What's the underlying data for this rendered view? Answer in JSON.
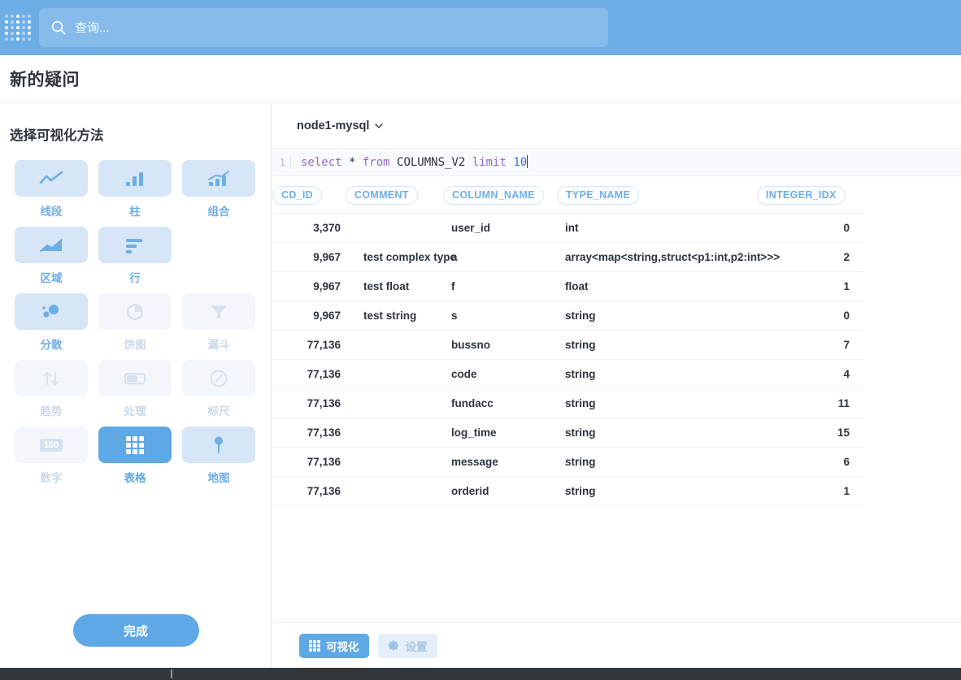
{
  "topbar": {
    "logo_name": "app-logo",
    "search": {
      "placeholder": "查询...",
      "value": "",
      "icon": "search-icon"
    },
    "bg_color": "#6EAEE7"
  },
  "header": {
    "title": "新的疑问"
  },
  "sidebar": {
    "title": "选择可视化方法",
    "done_label": "完成",
    "items": [
      {
        "label": "线段",
        "icon": "line-chart-icon",
        "state": "enabled"
      },
      {
        "label": "柱",
        "icon": "bar-chart-icon",
        "state": "enabled"
      },
      {
        "label": "组合",
        "icon": "combo-chart-icon",
        "state": "enabled"
      },
      {
        "label": "区域",
        "icon": "area-chart-icon",
        "state": "enabled"
      },
      {
        "label": "行",
        "icon": "row-chart-icon",
        "state": "enabled"
      },
      {
        "label": "",
        "icon": "",
        "state": "empty"
      },
      {
        "label": "分散",
        "icon": "scatter-chart-icon",
        "state": "enabled"
      },
      {
        "label": "饼图",
        "icon": "pie-chart-icon",
        "state": "disabled"
      },
      {
        "label": "漏斗",
        "icon": "funnel-icon",
        "state": "disabled"
      },
      {
        "label": "趋势",
        "icon": "trend-arrows-icon",
        "state": "disabled"
      },
      {
        "label": "处理",
        "icon": "progress-icon",
        "state": "disabled"
      },
      {
        "label": "标尺",
        "icon": "gauge-icon",
        "state": "disabled"
      },
      {
        "label": "数字",
        "icon": "number-100-icon",
        "state": "disabled"
      },
      {
        "label": "表格",
        "icon": "table-grid-icon",
        "state": "selected"
      },
      {
        "label": "地图",
        "icon": "map-pin-icon",
        "state": "enabled"
      }
    ],
    "badge_text": "100"
  },
  "main": {
    "database": {
      "name": "node1-mysql",
      "chevron": "chevron-down-icon"
    },
    "editor": {
      "line_number": "1",
      "tokens": [
        {
          "text": "select",
          "type": "keyword"
        },
        {
          "text": " * ",
          "type": "plain"
        },
        {
          "text": "from",
          "type": "keyword"
        },
        {
          "text": " COLUMNS_V2 ",
          "type": "plain"
        },
        {
          "text": "limit",
          "type": "keyword"
        },
        {
          "text": " ",
          "type": "plain"
        },
        {
          "text": "10",
          "type": "number"
        }
      ],
      "full_text": "select * from COLUMNS_V2 limit 10"
    },
    "table": {
      "columns": [
        "CD_ID",
        "COMMENT",
        "COLUMN_NAME",
        "TYPE_NAME",
        "INTEGER_IDX"
      ],
      "rows": [
        [
          "3,370",
          "",
          "user_id",
          "int",
          "0"
        ],
        [
          "9,967",
          "test complex type",
          "a",
          "array<map<string,struct<p1:int,p2:int>>>",
          "2"
        ],
        [
          "9,967",
          "test float",
          "f",
          "float",
          "1"
        ],
        [
          "9,967",
          "test string",
          "s",
          "string",
          "0"
        ],
        [
          "77,136",
          "",
          "bussno",
          "string",
          "7"
        ],
        [
          "77,136",
          "",
          "code",
          "string",
          "4"
        ],
        [
          "77,136",
          "",
          "fundacc",
          "string",
          "11"
        ],
        [
          "77,136",
          "",
          "log_time",
          "string",
          "15"
        ],
        [
          "77,136",
          "",
          "message",
          "string",
          "6"
        ],
        [
          "77,136",
          "",
          "orderid",
          "string",
          "1"
        ]
      ]
    },
    "toolbar": {
      "visualize_label": "可视化",
      "visualize_icon": "table-grid-icon",
      "settings_label": "设置",
      "settings_icon": "gear-icon"
    }
  },
  "colors": {
    "accent": "#5EA8E5",
    "topbar": "#6EAEE7",
    "tile": "#D6E6F7",
    "tile_disabled": "#F3F6FA",
    "text": "#2E353B",
    "taskbar": "#33383D"
  }
}
